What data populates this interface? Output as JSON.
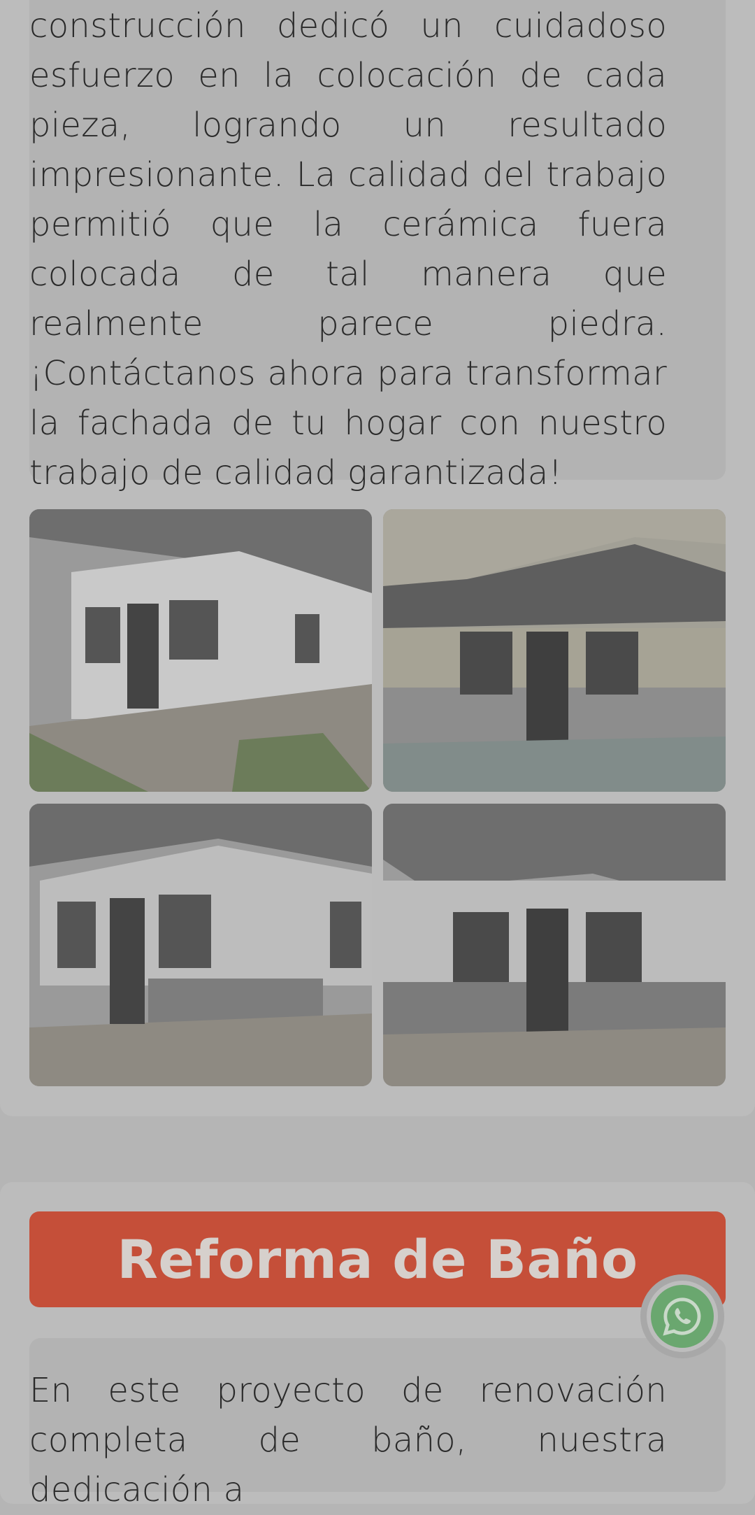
{
  "project1": {
    "paragraph_end": "construcción dedicó un cuidadoso esfuerzo en la colocación de cada pieza, logrando un resultado impresionante. La calidad del trabajo permitió que la cerámica fuera colocada de tal manera que realmente parece piedra. ¡Contáctanos ahora para transformar la fachada de tu hogar con nuestro trabajo de calidad garantizada!",
    "photos": [
      "facade-before-1",
      "facade-after-1",
      "facade-after-2",
      "facade-after-3"
    ]
  },
  "project2": {
    "title": "Reforma de Baño",
    "paragraph_start": "En este proyecto de renovación completa de baño, nuestra dedicación a"
  },
  "floating": {
    "icon": "whatsapp-icon"
  },
  "colors": {
    "accent": "#c54f39",
    "whatsapp": "#6aa76f"
  }
}
